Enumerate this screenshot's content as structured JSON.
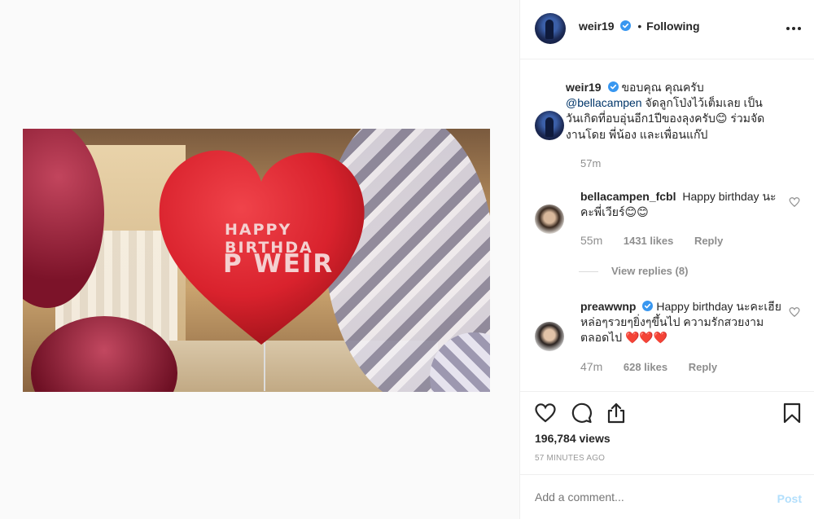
{
  "post": {
    "username": "weir19",
    "follow_status": "Following",
    "separator": "•"
  },
  "colors": {
    "verified": "#3897f0",
    "link": "#003569",
    "muted": "#8e8e8e",
    "accent_red": "#ed2e50"
  },
  "video": {
    "balloon_line1": "HAPPY BIRTHDA",
    "balloon_line2": "P WEIR"
  },
  "caption": {
    "username": "weir19",
    "mention": "@bellacampen",
    "text_before_emoji": "ขอบคุณ คุณครับ",
    "text_after_mention": "จัดลูกโป่งไว้เต็มเลย เป็นวันเกิดที่อบอุ่นอีก1ปีของลุงครับ",
    "emoji1": "😊",
    "text_end": "ร่วมจัดงานโดย พี่น้อง และเพื่อนแก๊ป",
    "time": "57m"
  },
  "comments": [
    {
      "username": "bellacampen_fcbl",
      "text": "Happy birthday นะคะพี่เวียร์",
      "emojis": "😊😊",
      "time": "55m",
      "likes": "1431 likes",
      "reply": "Reply",
      "view_replies": "View replies (8)"
    },
    {
      "username": "preawwnp",
      "text": "Happy birthday นะคะเฮีย หล่อๆรวยๆยิ่งๆขึ้นไป ความรักสวยงามตลอดไป",
      "emojis": "❤️❤️❤️",
      "time": "47m",
      "likes": "628 likes",
      "reply": "Reply"
    }
  ],
  "actions": {
    "views": "196,784 views",
    "time_ago": "57 MINUTES AGO"
  },
  "add_comment": {
    "placeholder": "Add a comment...",
    "post_label": "Post"
  },
  "icons": [
    "verified-badge-icon",
    "more-options-icon",
    "like-heart-icon",
    "comment-icon",
    "share-icon",
    "save-bookmark-icon"
  ]
}
